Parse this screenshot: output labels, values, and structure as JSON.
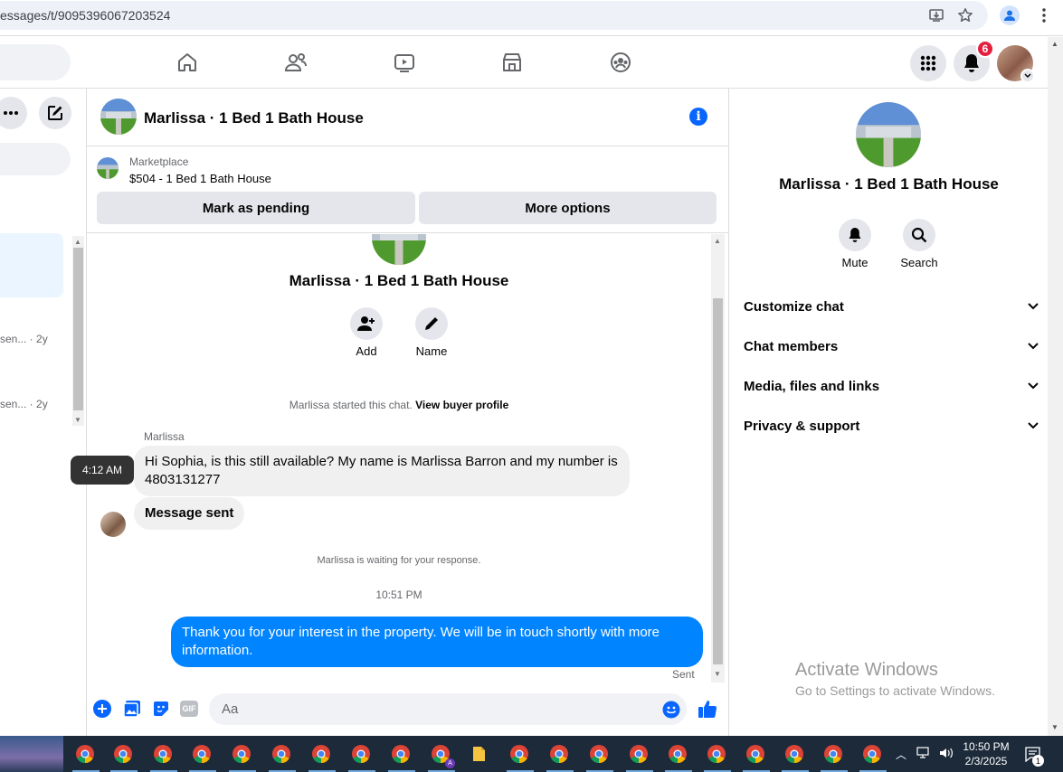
{
  "browser": {
    "url": "essages/t/9095396067203524"
  },
  "fb_nav": {
    "notification_count": "6"
  },
  "left_sidebar": {
    "snippets": [
      {
        "text": "sen... · 2y"
      },
      {
        "text": "sen... · 2y"
      }
    ]
  },
  "chat": {
    "title": "Marlissa · 1 Bed 1 Bath House",
    "marketplace": {
      "label": "Marketplace",
      "listing": "$504 - 1 Bed 1 Bath House",
      "mark_pending_label": "Mark as pending",
      "more_options_label": "More options"
    },
    "intro": {
      "title": "Marlissa · 1 Bed 1 Bath House",
      "add_label": "Add",
      "name_label": "Name",
      "started_text": "Marlissa started this chat.",
      "view_profile_link": "View buyer profile"
    },
    "messages": {
      "sender_name": "Marlissa",
      "incoming_text": "Hi Sophia, is this still available? My name is Marlissa Barron and my number is 4803131277",
      "tooltip_time": "4:12 AM",
      "message_sent_text": "Message sent",
      "waiting_text": "Marlissa is waiting for your response.",
      "timestamp": "10:51 PM",
      "outgoing_text": "Thank you for your interest in the property. We will be in touch shortly with more information.",
      "status": "Sent"
    },
    "composer": {
      "placeholder": "Aa"
    }
  },
  "right_pane": {
    "title": "Marlissa · 1 Bed 1 Bath House",
    "mute_label": "Mute",
    "search_label": "Search",
    "sections": [
      {
        "label": "Customize chat"
      },
      {
        "label": "Chat members"
      },
      {
        "label": "Media, files and links"
      },
      {
        "label": "Privacy & support"
      }
    ],
    "watermark_title": "Activate Windows",
    "watermark_sub": "Go to Settings to activate Windows."
  },
  "taskbar": {
    "time": "10:50 PM",
    "date": "2/3/2025",
    "notif_count": "1"
  },
  "colors": {
    "brand_blue": "#0866ff",
    "outgoing_bubble": "#0084ff",
    "badge_red": "#e41e3f"
  }
}
